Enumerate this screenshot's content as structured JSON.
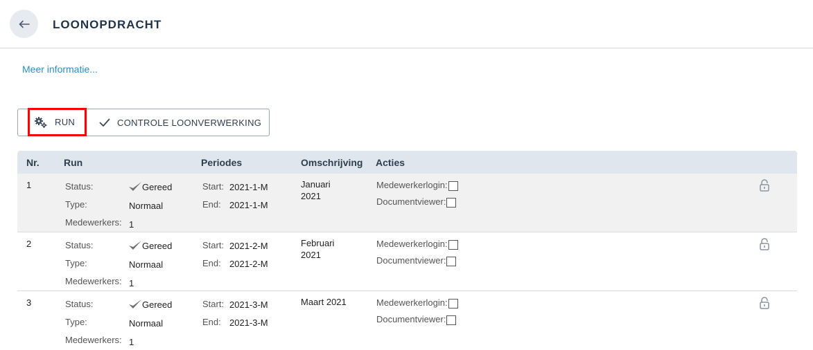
{
  "header": {
    "title": "LOONOPDRACHT",
    "back_icon": "arrow-left-icon"
  },
  "more_info": "Meer informatie...",
  "toolbar": {
    "run_label": "RUN",
    "check_label": "CONTROLE LOONVERWERKING"
  },
  "table": {
    "headers": {
      "nr": "Nr.",
      "run": "Run",
      "periods": "Periodes",
      "description": "Omschrijving",
      "actions": "Acties"
    },
    "labels": {
      "status": "Status:",
      "type": "Type:",
      "employees": "Medewerkers:",
      "start": "Start:",
      "end": "End:",
      "login": "Medewerkerlogin:",
      "viewer": "Documentviewer:"
    },
    "rows": [
      {
        "nr": "1",
        "status": "Gereed",
        "type": "Normaal",
        "employees": "1",
        "start": "2021-1-M",
        "end": "2021-1-M",
        "desc_line1": "Januari",
        "desc_line2": "2021"
      },
      {
        "nr": "2",
        "status": "Gereed",
        "type": "Normaal",
        "employees": "1",
        "start": "2021-2-M",
        "end": "2021-2-M",
        "desc_line1": "Februari",
        "desc_line2": "2021"
      },
      {
        "nr": "3",
        "status": "Gereed",
        "type": "Normaal",
        "employees": "1",
        "start": "2021-3-M",
        "end": "2021-3-M",
        "desc_line1": "Maart 2021",
        "desc_line2": ""
      }
    ]
  },
  "colors": {
    "accent_link": "#2a8fc7",
    "header_bg": "#dfe6ee",
    "highlight": "#ff0000"
  }
}
